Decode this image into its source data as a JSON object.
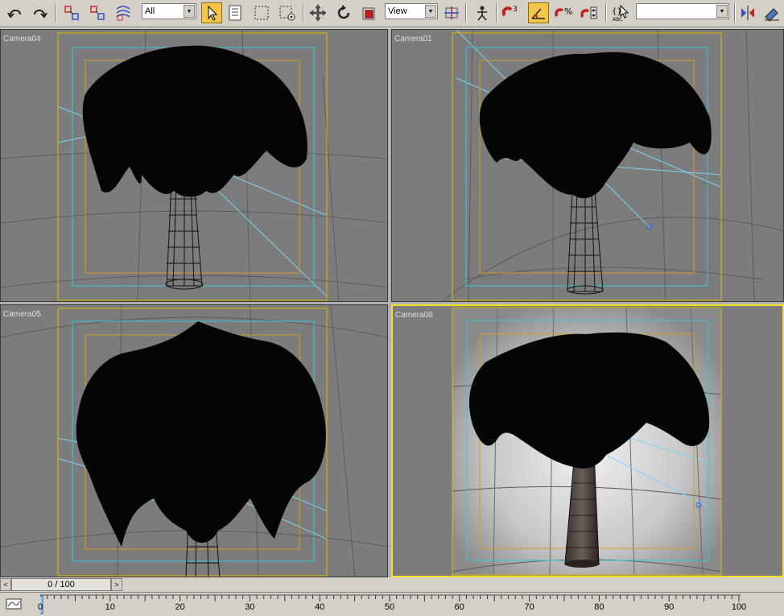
{
  "toolbar": {
    "undo": "undo-icon",
    "redo": "redo-icon",
    "selection_filter": "All",
    "reference_coord": "View",
    "named_selection": ""
  },
  "viewports": [
    {
      "label": "Camera04",
      "active": false,
      "shaded": false
    },
    {
      "label": "Camera01",
      "active": false,
      "shaded": false
    },
    {
      "label": "Camera05",
      "active": false,
      "shaded": false
    },
    {
      "label": "Camera06",
      "active": true,
      "shaded": true
    }
  ],
  "timeslider": {
    "frame_display": "0 / 100",
    "prev": "<",
    "next": ">"
  },
  "trackbar": {
    "ticks": [
      "0",
      "10",
      "20",
      "30",
      "40",
      "50",
      "60",
      "70",
      "80",
      "90",
      "100"
    ],
    "current_frame": 0
  },
  "colors": {
    "safe_frame_outer": "#d4b800",
    "safe_frame_action": "#39c6d6",
    "safe_frame_title": "#d49a20",
    "active_border": "#f0e02a",
    "camera_line": "#7fd2f0"
  }
}
